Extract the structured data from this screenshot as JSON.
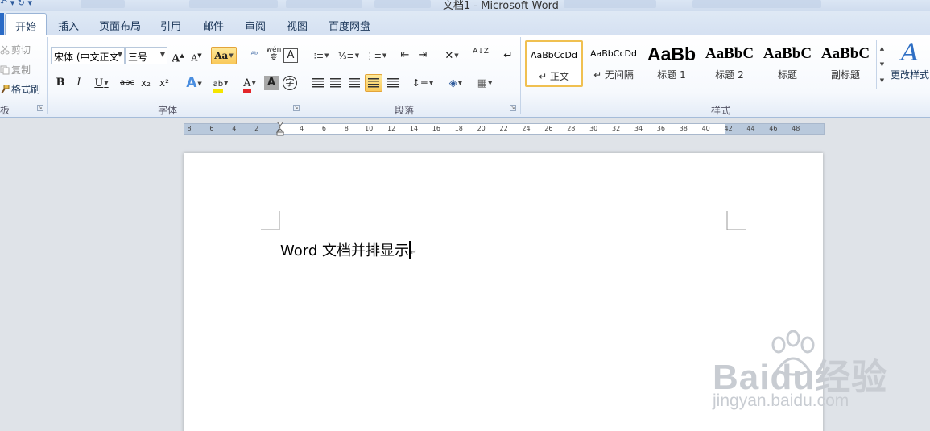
{
  "window": {
    "title": "文档1 - Microsoft Word"
  },
  "tabs": [
    {
      "label": "开始",
      "active": true
    },
    {
      "label": "插入"
    },
    {
      "label": "页面布局"
    },
    {
      "label": "引用"
    },
    {
      "label": "邮件"
    },
    {
      "label": "审阅"
    },
    {
      "label": "视图"
    },
    {
      "label": "百度网盘"
    }
  ],
  "clipboard": {
    "cut": "剪切",
    "copy": "复制",
    "format_painter": "格式刷",
    "group_label": "板"
  },
  "font": {
    "family": "宋体 (中文正文",
    "size": "三号",
    "group_label": "字体",
    "grow": "A",
    "shrink": "A",
    "change_case": "Aa",
    "pinyin": "wén",
    "bold": "B",
    "italic": "I",
    "underline": "U",
    "strike": "abc",
    "subscript": "x₂",
    "superscript": "x²",
    "text_effect": "A",
    "highlight": "ab",
    "font_color": "A",
    "char_shade": "A",
    "enclose": "字",
    "border_char": "A"
  },
  "paragraph": {
    "group_label": "段落",
    "sort": "A↓Z"
  },
  "styles": {
    "group_label": "样式",
    "items": [
      {
        "sample": "AaBbCcDd",
        "name": "↵ 正文",
        "selected": true
      },
      {
        "sample": "AaBbCcDd",
        "name": "↵ 无间隔"
      },
      {
        "sample": "AaBb",
        "name": "标题 1"
      },
      {
        "sample": "AaBbC",
        "name": "标题 2"
      },
      {
        "sample": "AaBbC",
        "name": "标题"
      },
      {
        "sample": "AaBbC",
        "name": "副标题"
      }
    ],
    "change_styles": "更改样式",
    "change_icon": "A"
  },
  "ruler": {
    "ticks": [
      "8",
      "6",
      "4",
      "2",
      "2",
      "4",
      "6",
      "8",
      "10",
      "12",
      "14",
      "16",
      "18",
      "20",
      "22",
      "24",
      "26",
      "28",
      "30",
      "32",
      "34",
      "36",
      "38",
      "40",
      "42",
      "44",
      "46",
      "48"
    ]
  },
  "document": {
    "text": "Word 文档并排显示",
    "para_mark": "↵"
  },
  "watermark": {
    "brand": "Baidu经验",
    "url": "jingyan.baidu.com"
  },
  "colors": {
    "accent": "#2a6bc6",
    "font_color_bar": "#e3262a",
    "highlight_bar": "#f5e500",
    "selected_border": "#f0c050"
  }
}
